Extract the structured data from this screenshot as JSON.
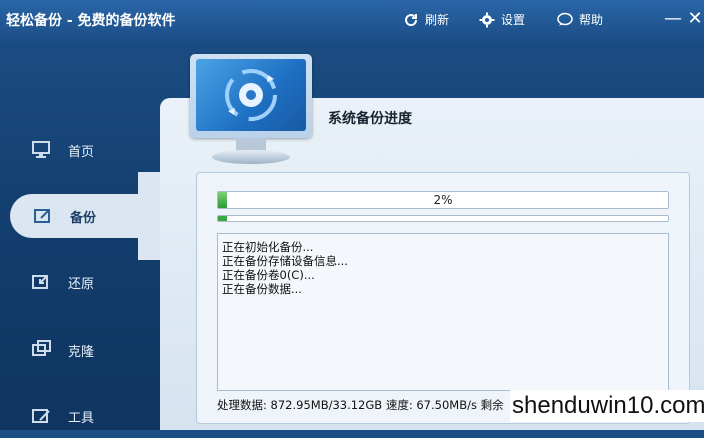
{
  "app": {
    "title": "轻松备份 - 免费的备份软件"
  },
  "toolbar": {
    "refresh": "刷新",
    "settings": "设置",
    "help": "帮助",
    "minimize": "—",
    "close": "✕"
  },
  "sidebar": {
    "items": [
      {
        "label": "首页",
        "icon": "monitor-home-icon"
      },
      {
        "label": "备份",
        "icon": "backup-icon",
        "active": true
      },
      {
        "label": "还原",
        "icon": "restore-icon"
      },
      {
        "label": "克隆",
        "icon": "clone-icon"
      },
      {
        "label": "工具",
        "icon": "tools-icon"
      }
    ]
  },
  "main": {
    "title": "系统备份进度",
    "progress": {
      "text": "2%",
      "value": 0.02,
      "sub_value": 0.02
    },
    "log": [
      "正在初始化备份...",
      "正在备份存储设备信息...",
      "正在备份卷0(C)...",
      "正在备份数据..."
    ],
    "status": "处理数据: 872.95MB/33.12GB  速度: 67.50MB/s  剩余"
  },
  "watermark": "shenduwin10.com",
  "colors": {
    "accent": "#1b4d86",
    "progress": "#2c9b36",
    "panel": "#dbe6f2"
  }
}
